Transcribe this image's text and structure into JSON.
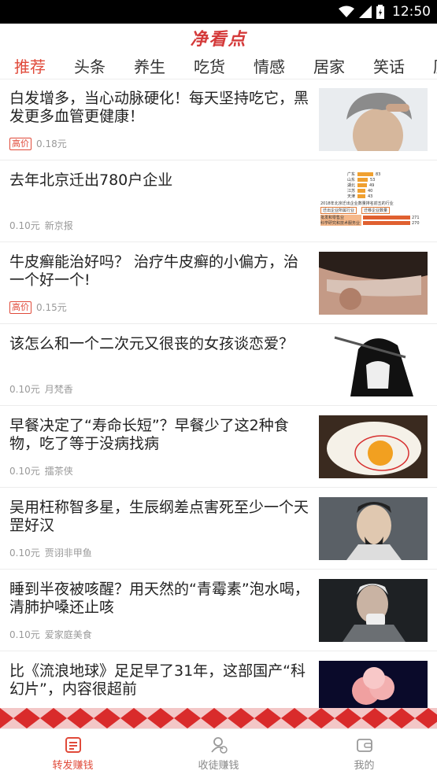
{
  "status_bar": {
    "time": "12:50"
  },
  "app": {
    "logo": "净看点"
  },
  "tabs": [
    {
      "label": "推荐",
      "active": true
    },
    {
      "label": "头条"
    },
    {
      "label": "养生"
    },
    {
      "label": "吃货"
    },
    {
      "label": "情感"
    },
    {
      "label": "居家"
    },
    {
      "label": "笑话"
    },
    {
      "label": "历"
    }
  ],
  "articles": [
    {
      "title": "白发增多，当心动脉硬化！每天坚持吃它，黑发更多血管更健康！",
      "badge": "高价",
      "price": "0.18元",
      "source": "",
      "thumb": "man-gray-hair"
    },
    {
      "title": "去年北京迁出780户企业",
      "badge": "",
      "price": "0.10元",
      "source": "新京报",
      "thumb": "bar-chart-table"
    },
    {
      "title": "牛皮癣能治好吗？ 治疗牛皮癣的小偏方，治一个好一个!",
      "badge": "高价",
      "price": "0.15元",
      "source": "",
      "thumb": "scalp-psoriasis"
    },
    {
      "title": "该怎么和一个二次元又很丧的女孩谈恋爱？",
      "badge": "",
      "price": "0.10元",
      "source": "月梵香",
      "thumb": "anime-girl-sketch"
    },
    {
      "title": "早餐决定了“寿命长短”？早餐少了这2种食物，吃了等于没病找病",
      "badge": "",
      "price": "0.10元",
      "source": "擂茶侠",
      "thumb": "fried-egg"
    },
    {
      "title": "吴用枉称智多星，生辰纲差点害死至少一个天罡好汉",
      "badge": "",
      "price": "0.10元",
      "source": "贾诩非甲鱼",
      "thumb": "actor-portrait"
    },
    {
      "title": "睡到半夜被咳醒？用天然的“青霉素”泡水喝，清肺护嗓还止咳",
      "badge": "",
      "price": "0.10元",
      "source": "爱家庭美食",
      "thumb": "old-man-coughing"
    },
    {
      "title": "比《流浪地球》足足早了31年，这部国产“科幻片”，内容很超前",
      "badge": "",
      "price": "",
      "source": "",
      "thumb": "explosion-cloud"
    }
  ],
  "thumb_chart": {
    "rows": [
      {
        "label": "广东",
        "value": "83"
      },
      {
        "label": "山东",
        "value": "53"
      },
      {
        "label": "湖北",
        "value": "49"
      },
      {
        "label": "江苏",
        "value": "40"
      },
      {
        "label": "天津",
        "value": "43"
      }
    ],
    "caption": "2018年北京迁出企业数量排名前五的行业",
    "col1": "迁出企业所属行业",
    "col2": "迁移企业数量",
    "table_rows": [
      {
        "label": "批发和零售业",
        "value": "271"
      },
      {
        "label": "科学研究和技术服务业",
        "value": "270"
      }
    ]
  },
  "bottom_nav": [
    {
      "label": "转发赚钱",
      "icon": "news-icon",
      "active": true
    },
    {
      "label": "收徒赚钱",
      "icon": "user-coin-icon",
      "active": false
    },
    {
      "label": "我的",
      "icon": "wallet-icon",
      "active": false
    }
  ],
  "colors": {
    "accent": "#e04a3a",
    "pattern_red": "#d92b2b"
  }
}
